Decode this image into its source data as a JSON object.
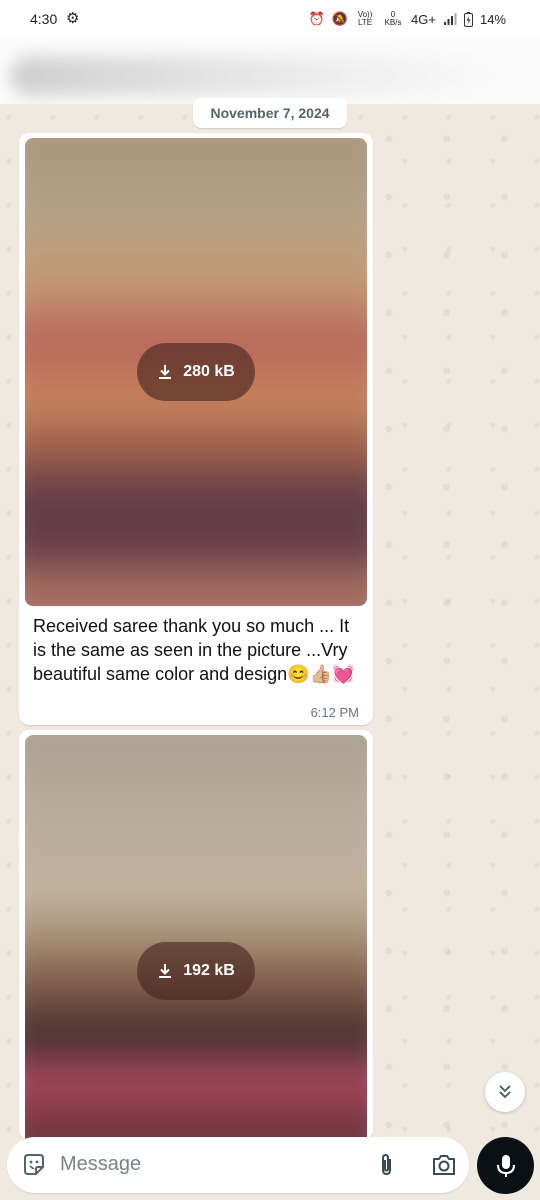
{
  "status_bar": {
    "time": "4:30",
    "settings_glyph": "⚙",
    "alarm_glyph": "⏰",
    "mute_glyph": "🔕",
    "volte": "Vo)) LTE",
    "data_rate": "0 KB/s",
    "network": "4G+",
    "battery": "14%"
  },
  "chat_header": {
    "contact_name": "",
    "back_glyph": "⬅"
  },
  "chat": {
    "date_chip": "November 7, 2024",
    "messages": [
      {
        "type": "image",
        "download_size": "280 kB",
        "caption": "Received saree thank you so much ... It is the same as seen in the picture ...Vry beautiful same color and design😊👍🏼💓",
        "time": "6:12 PM"
      },
      {
        "type": "image",
        "download_size": "192 kB"
      }
    ]
  },
  "composer": {
    "placeholder": "Message"
  },
  "icons": {
    "sticker": "sticker-icon",
    "attach": "paperclip-icon",
    "camera": "camera-icon",
    "mic": "mic-icon",
    "scroll_down": "chevrons-down-icon",
    "download": "download-icon"
  },
  "colors": {
    "chat_background": "#efe9df",
    "bubble": "#ffffff",
    "mic_button": "#0b1014",
    "timestamp": "#667781"
  }
}
